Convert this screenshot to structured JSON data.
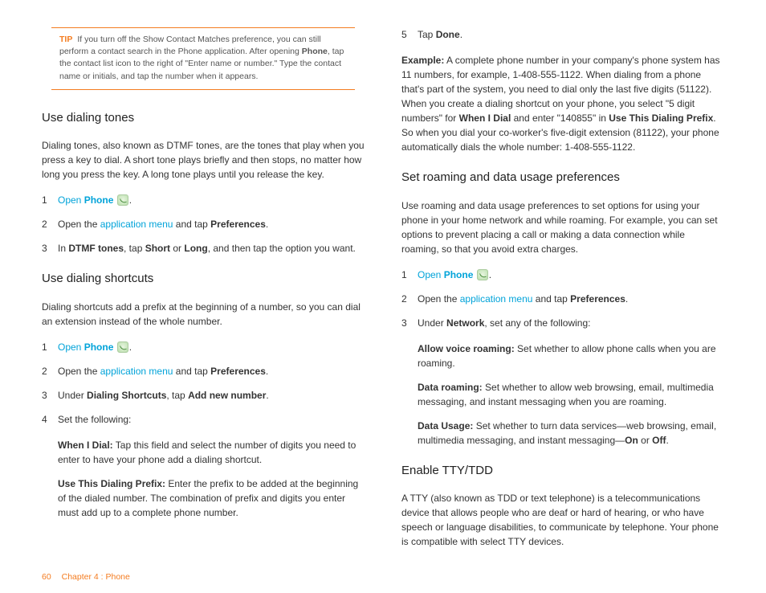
{
  "tip": {
    "label": "TIP",
    "text_a": "If you turn off the Show Contact Matches preference, you can still perform a contact search in the Phone application. After opening ",
    "bold_a": "Phone",
    "text_b": ", tap the contact list icon to the right of \"Enter name or number.\" Type the contact name or initials, and tap the number when it appears."
  },
  "left": {
    "h1": "Use dialing tones",
    "p1": "Dialing tones, also known as DTMF tones, are the tones that play when you press a key to dial. A short tone plays briefly and then stops, no matter how long you press the key. A long tone plays until you release the key.",
    "s1": {
      "open": "Open ",
      "phone": "Phone",
      "dot": "."
    },
    "s2": {
      "a": "Open the ",
      "link": "application menu",
      "b": " and tap ",
      "bold": "Preferences",
      "c": "."
    },
    "s3": {
      "a": "In ",
      "b1": "DTMF tones",
      "b": ", tap ",
      "b2": "Short",
      "c": " or ",
      "b3": "Long",
      "d": ", and then tap the option you want."
    },
    "h2": "Use dialing shortcuts",
    "p2": "Dialing shortcuts add a prefix at the beginning of a number, so you can dial an extension instead of the whole number.",
    "s4": {
      "open": "Open ",
      "phone": "Phone",
      "dot": "."
    },
    "s5": {
      "a": "Open the ",
      "link": "application menu",
      "b": " and tap ",
      "bold": "Preferences",
      "c": "."
    },
    "s6": {
      "a": "Under ",
      "b1": "Dialing Shortcuts",
      "b": ", tap ",
      "b2": "Add new number",
      "c": "."
    },
    "s7": "Set the following:",
    "sub1": {
      "bold": "When I Dial:",
      "text": " Tap this field and select the number of digits you need to enter to have your phone add a dialing shortcut."
    },
    "sub2": {
      "bold": "Use This Dialing Prefix:",
      "text": " Enter the prefix to be added at the beginning of the dialed number. The combination of prefix and digits you enter must add up to a complete phone number."
    }
  },
  "right": {
    "s5": {
      "a": "Tap ",
      "bold": "Done",
      "b": "."
    },
    "ex": {
      "bold0": "Example:",
      "t1": " A complete phone number in your company's phone system has 11 numbers, for example, 1-408-555-1122. When dialing from a phone that's part of the system, you need to dial only the last five digits (51122). When you create a dialing shortcut on your phone, you select \"5 digit numbers\" for ",
      "b1": "When I Dial",
      "t2": " and enter \"140855\" in ",
      "b2": "Use This Dialing Prefix",
      "t3": ". So when you dial your co-worker's five-digit extension (81122), your phone automatically dials the whole number: 1-408-555-1122."
    },
    "h1": "Set roaming and data usage preferences",
    "p1": "Use roaming and data usage preferences to set options for using your phone in your home network and while roaming. For example, you can set options to prevent placing a call or making a data connection while roaming, so that you avoid extra charges.",
    "s1": {
      "open": "Open ",
      "phone": "Phone",
      "dot": "."
    },
    "s2": {
      "a": "Open the ",
      "link": "application menu",
      "b": " and tap ",
      "bold": "Preferences",
      "c": "."
    },
    "s3": {
      "a": "Under ",
      "bold": "Network",
      "b": ", set any of the following:"
    },
    "sub1": {
      "bold": "Allow voice roaming:",
      "text": " Set whether to allow phone calls when you are roaming."
    },
    "sub2": {
      "bold": "Data roaming:",
      "text": " Set whether to allow web browsing, email, multimedia messaging, and instant messaging when you are roaming."
    },
    "sub3": {
      "bold": "Data Usage:",
      "t1": " Set whether to turn data services—web browsing, email, multimedia messaging, and instant messaging—",
      "b1": "On",
      "t2": " or ",
      "b2": "Off",
      "t3": "."
    },
    "h2": "Enable TTY/TDD",
    "p2": "A TTY (also known as TDD or text telephone) is a telecommunications device that allows people who are deaf or hard of hearing, or who have speech or language disabilities, to communicate by telephone. Your phone is compatible with select TTY devices."
  },
  "footer": {
    "page": "60",
    "chapter": "Chapter 4 : Phone"
  }
}
